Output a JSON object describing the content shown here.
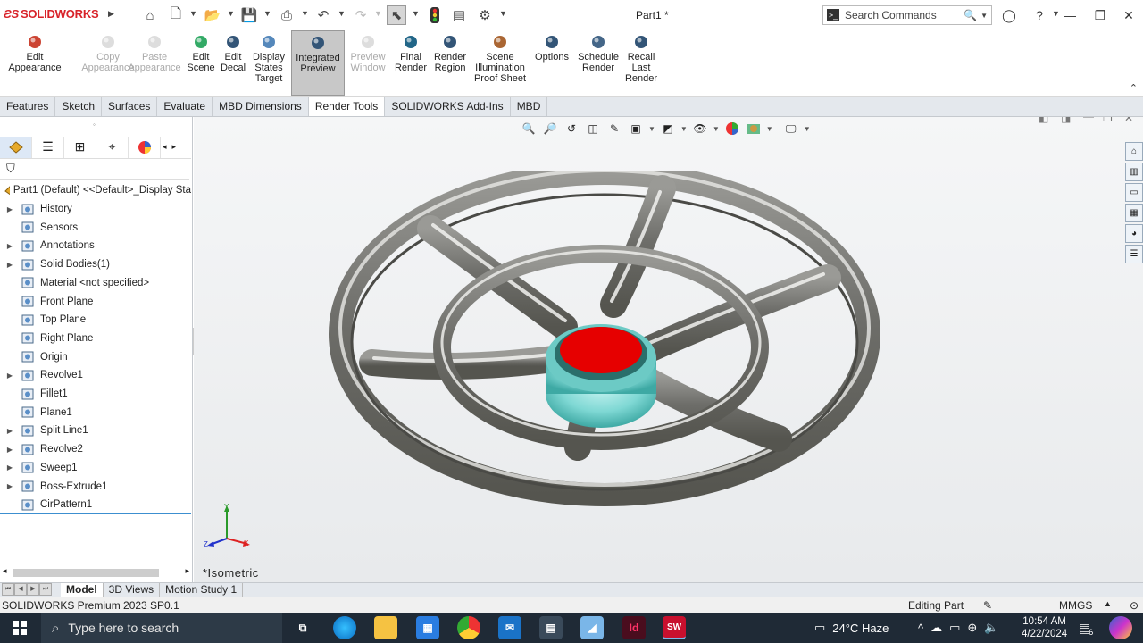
{
  "app": {
    "brand": "SOLIDWORKS",
    "doc_title": "Part1 *",
    "search_placeholder": "Search Commands"
  },
  "ribbon": {
    "items": [
      {
        "label": "Edit\nAppearance",
        "disabled": false
      },
      {
        "label": "Copy\nAppearance",
        "disabled": true
      },
      {
        "label": "Paste\nAppearance",
        "disabled": true
      },
      {
        "label": "Edit\nScene",
        "disabled": false
      },
      {
        "label": "Edit\nDecal",
        "disabled": false
      },
      {
        "label": "Display\nStates\nTarget",
        "disabled": false
      },
      {
        "label": "Integrated\nPreview",
        "disabled": false,
        "active": true
      },
      {
        "label": "Preview\nWindow",
        "disabled": true
      },
      {
        "label": "Final\nRender",
        "disabled": false
      },
      {
        "label": "Render\nRegion",
        "disabled": false
      },
      {
        "label": "Scene\nIllumination\nProof Sheet",
        "disabled": false
      },
      {
        "label": "Options",
        "disabled": false
      },
      {
        "label": "Schedule\nRender",
        "disabled": false
      },
      {
        "label": "Recall\nLast\nRender",
        "disabled": false
      }
    ]
  },
  "tabs": [
    "Features",
    "Sketch",
    "Surfaces",
    "Evaluate",
    "MBD Dimensions",
    "Render Tools",
    "SOLIDWORKS Add-Ins",
    "MBD"
  ],
  "active_tab": "Render Tools",
  "tree": {
    "root": "Part1 (Default) <<Default>_Display Sta",
    "items": [
      {
        "label": "History",
        "expandable": true,
        "icon": "history-icon"
      },
      {
        "label": "Sensors",
        "expandable": false,
        "icon": "sensor-icon"
      },
      {
        "label": "Annotations",
        "expandable": true,
        "icon": "annotation-icon"
      },
      {
        "label": "Solid Bodies(1)",
        "expandable": true,
        "icon": "solid-bodies-icon"
      },
      {
        "label": "Material <not specified>",
        "expandable": false,
        "icon": "material-icon"
      },
      {
        "label": "Front Plane",
        "expandable": false,
        "icon": "plane-icon"
      },
      {
        "label": "Top Plane",
        "expandable": false,
        "icon": "plane-icon"
      },
      {
        "label": "Right Plane",
        "expandable": false,
        "icon": "plane-icon"
      },
      {
        "label": "Origin",
        "expandable": false,
        "icon": "origin-icon"
      },
      {
        "label": "Revolve1",
        "expandable": true,
        "icon": "revolve-icon"
      },
      {
        "label": "Fillet1",
        "expandable": false,
        "icon": "fillet-icon"
      },
      {
        "label": "Plane1",
        "expandable": false,
        "icon": "plane-icon"
      },
      {
        "label": "Split Line1",
        "expandable": true,
        "icon": "split-line-icon"
      },
      {
        "label": "Revolve2",
        "expandable": true,
        "icon": "revolve-icon"
      },
      {
        "label": "Sweep1",
        "expandable": true,
        "icon": "sweep-icon"
      },
      {
        "label": "Boss-Extrude1",
        "expandable": true,
        "icon": "extrude-icon"
      },
      {
        "label": "CirPattern1",
        "expandable": false,
        "icon": "pattern-icon"
      }
    ]
  },
  "viewport": {
    "view_label": "*Isometric",
    "triad": {
      "x": "X",
      "y": "Y",
      "z": "Z"
    }
  },
  "bottom_tabs": [
    "Model",
    "3D Views",
    "Motion Study 1"
  ],
  "active_bottom_tab": "Model",
  "status": {
    "product": "SOLIDWORKS Premium 2023 SP0.1",
    "mode": "Editing Part",
    "units": "MMGS"
  },
  "taskbar": {
    "search_placeholder": "Type here to search",
    "weather": "24°C  Haze",
    "time": "10:54 AM",
    "date": "4/22/2024",
    "notification_count": "6"
  },
  "colors": {
    "brand_red": "#d8232a",
    "hub_red": "#e60000",
    "hub_cyan": "#7fd8d4",
    "metal": "#7a7a76",
    "accent_blue": "#3c8fd0"
  }
}
